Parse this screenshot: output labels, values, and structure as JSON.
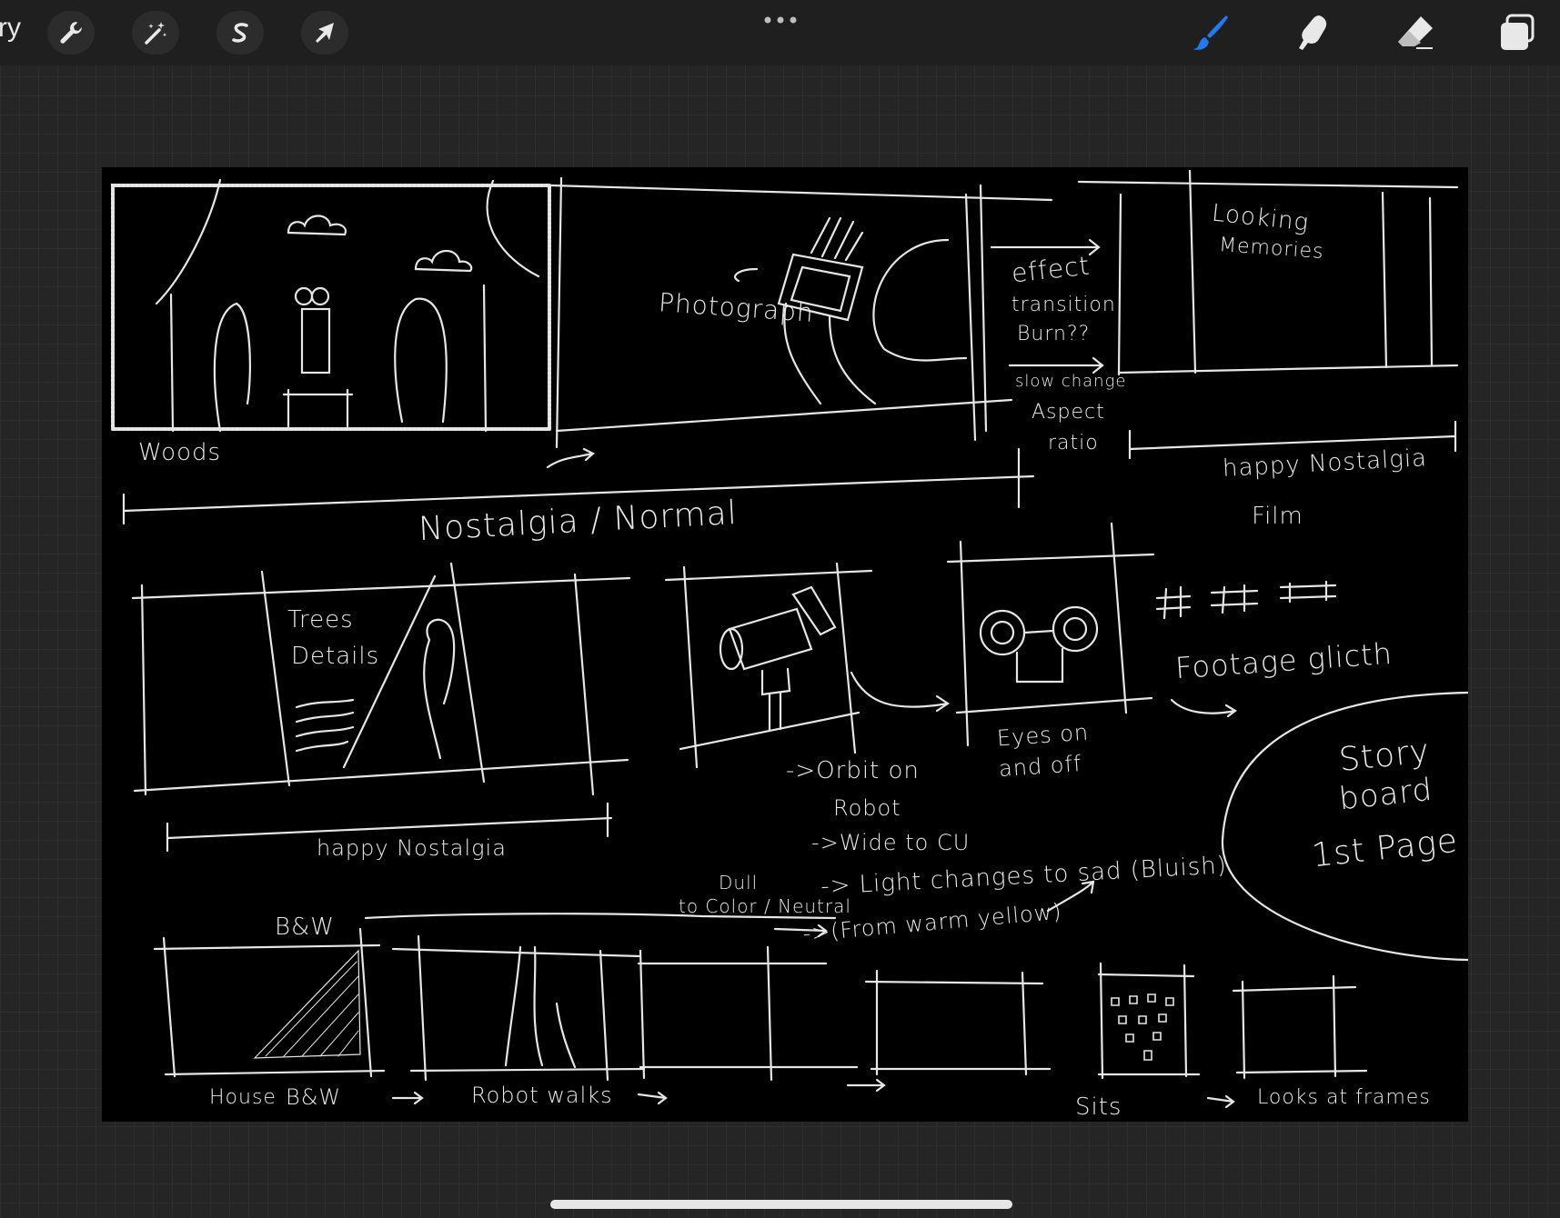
{
  "toolbar": {
    "gallery_label": "ry",
    "left_tools": [
      {
        "name": "actions",
        "icon": "wrench-icon"
      },
      {
        "name": "adjustments",
        "icon": "magic-wand-icon"
      },
      {
        "name": "selection",
        "icon": "selection-s-icon"
      },
      {
        "name": "transform",
        "icon": "arrow-cursor-icon"
      }
    ],
    "more_icon": "more-dots-icon",
    "right_tools": [
      {
        "name": "brush",
        "icon": "brush-icon",
        "active": true
      },
      {
        "name": "smudge",
        "icon": "smudge-finger-icon",
        "active": false
      },
      {
        "name": "eraser",
        "icon": "eraser-icon",
        "active": false
      },
      {
        "name": "layers",
        "icon": "layers-icon",
        "active": false
      }
    ],
    "active_color": "#1e7bf0"
  },
  "sketch": {
    "woods": "Woods",
    "photograph": "Photograph",
    "effect": "effect",
    "transition": "transition",
    "burn": "Burn??",
    "slow_change": "slow change",
    "aspect": "Aspect",
    "ratio": "ratio",
    "looking": "Looking",
    "memories": "Memories",
    "happy_nostalgia_film": "happy Nostalgia",
    "film": "Film",
    "nostalgia_normal": "Nostalgia / Normal",
    "trees": "Trees",
    "details": "Details",
    "eyes_on": "Eyes on",
    "and_off": "and off",
    "footage_glitch": "Footage glicth",
    "happy_nostalgia": "happy Nostalgia",
    "orbit": "->Orbit on",
    "robot": "Robot",
    "wide": "->Wide to CU",
    "dull": "Dull",
    "to_color": "to Color / Neutral",
    "light": "-> Light changes to sad (Bluish)",
    "from_warm": "->(From warm yellow)",
    "story": "Story",
    "board": "board",
    "first_page": "1st Page",
    "bw": "B&W",
    "house": "House",
    "house_bw": "B&W",
    "robot_walks": "Robot walks",
    "sits": "Sits",
    "looks": "Looks at frames"
  }
}
